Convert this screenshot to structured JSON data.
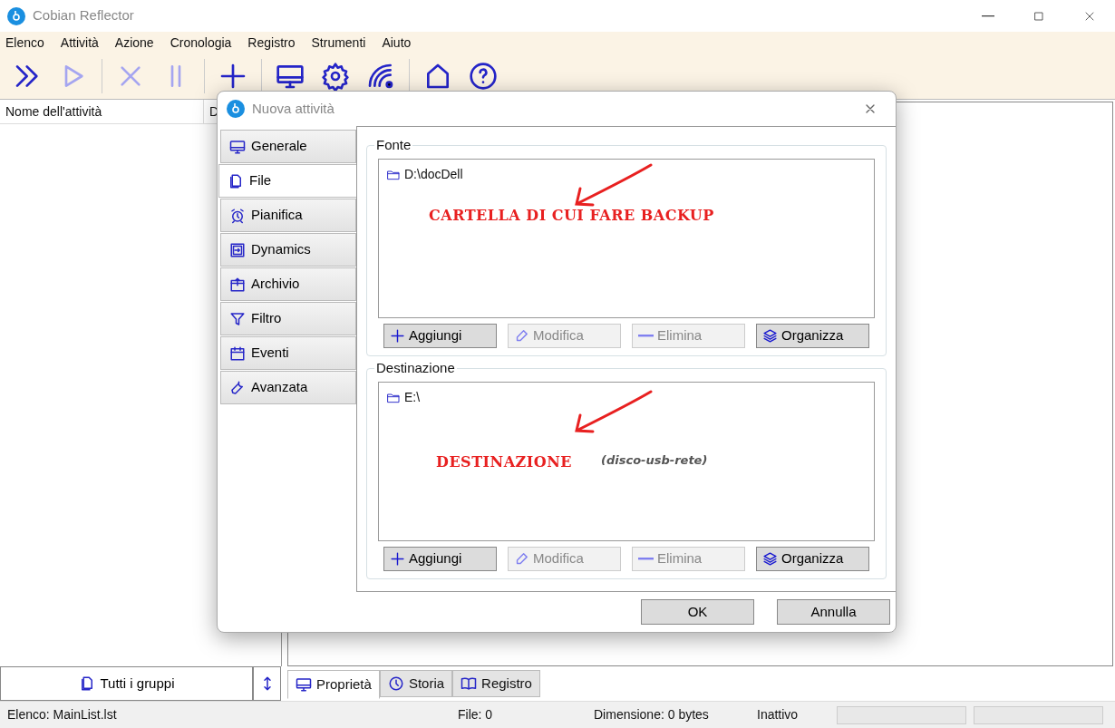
{
  "window": {
    "title": "Cobian Reflector"
  },
  "menu": [
    "Elenco",
    "Attività",
    "Azione",
    "Cronologia",
    "Registro",
    "Strumenti",
    "Aiuto"
  ],
  "toolbar": [
    {
      "kind": "run-all",
      "disabled": false
    },
    {
      "kind": "run",
      "disabled": true
    },
    {
      "kind": "separator"
    },
    {
      "kind": "stop",
      "disabled": true
    },
    {
      "kind": "pause",
      "disabled": true
    },
    {
      "kind": "separator"
    },
    {
      "kind": "add",
      "disabled": false
    },
    {
      "kind": "separator"
    },
    {
      "kind": "monitor",
      "disabled": false
    },
    {
      "kind": "gear",
      "disabled": false
    },
    {
      "kind": "signal",
      "disabled": false
    },
    {
      "kind": "separator"
    },
    {
      "kind": "home",
      "disabled": false
    },
    {
      "kind": "help",
      "disabled": false
    }
  ],
  "task_list": {
    "columns": [
      "Nome dell'attività",
      "D"
    ]
  },
  "groups_button": "Tutti i gruppi",
  "bottom_tabs": [
    {
      "label": "Proprietà",
      "kind": "monitor",
      "selected": true
    },
    {
      "label": "Storia",
      "kind": "clock",
      "selected": false
    },
    {
      "label": "Registro",
      "kind": "book",
      "selected": false
    }
  ],
  "status_bar": [
    "Elenco: MainList.lst",
    "File: 0",
    "Dimensione: 0 bytes",
    "Inattivo"
  ],
  "progress_bars": [
    {
      "level": 0
    },
    {
      "level": 0
    }
  ],
  "dialog": {
    "title": "Nuova attività",
    "tabs": [
      {
        "label": "Generale",
        "kind": "monitor",
        "selected": false
      },
      {
        "label": "File",
        "kind": "file",
        "selected": true
      },
      {
        "label": "Pianifica",
        "kind": "alarm",
        "selected": false
      },
      {
        "label": "Dynamics",
        "kind": "dynamics",
        "selected": false
      },
      {
        "label": "Archivio",
        "kind": "archive",
        "selected": false
      },
      {
        "label": "Filtro",
        "kind": "filter",
        "selected": false
      },
      {
        "label": "Eventi",
        "kind": "calendar",
        "selected": false
      },
      {
        "label": "Avanzata",
        "kind": "wrench",
        "selected": false
      }
    ],
    "sections": [
      {
        "title": "Fonte",
        "items": [
          "D:\\docDell"
        ],
        "annotation": {
          "text": "CARTELLA DI CUI FARE BACKUP"
        },
        "buttons": [
          {
            "label": "Aggiungi",
            "kind": "add",
            "disabled": false
          },
          {
            "label": "Modifica",
            "kind": "edit",
            "disabled": true
          },
          {
            "label": "Elimina",
            "kind": "remove",
            "disabled": true
          },
          {
            "label": "Organizza",
            "kind": "layers",
            "disabled": false
          }
        ]
      },
      {
        "title": "Destinazione",
        "items": [
          "E:\\"
        ],
        "annotation": {
          "text": "DESTINAZIONE",
          "note": "(disco-usb-rete)"
        },
        "buttons": [
          {
            "label": "Aggiungi",
            "kind": "add",
            "disabled": false
          },
          {
            "label": "Modifica",
            "kind": "edit",
            "disabled": true
          },
          {
            "label": "Elimina",
            "kind": "remove",
            "disabled": true
          },
          {
            "label": "Organizza",
            "kind": "layers",
            "disabled": false
          }
        ]
      }
    ],
    "buttons": [
      "OK",
      "Annulla"
    ]
  }
}
